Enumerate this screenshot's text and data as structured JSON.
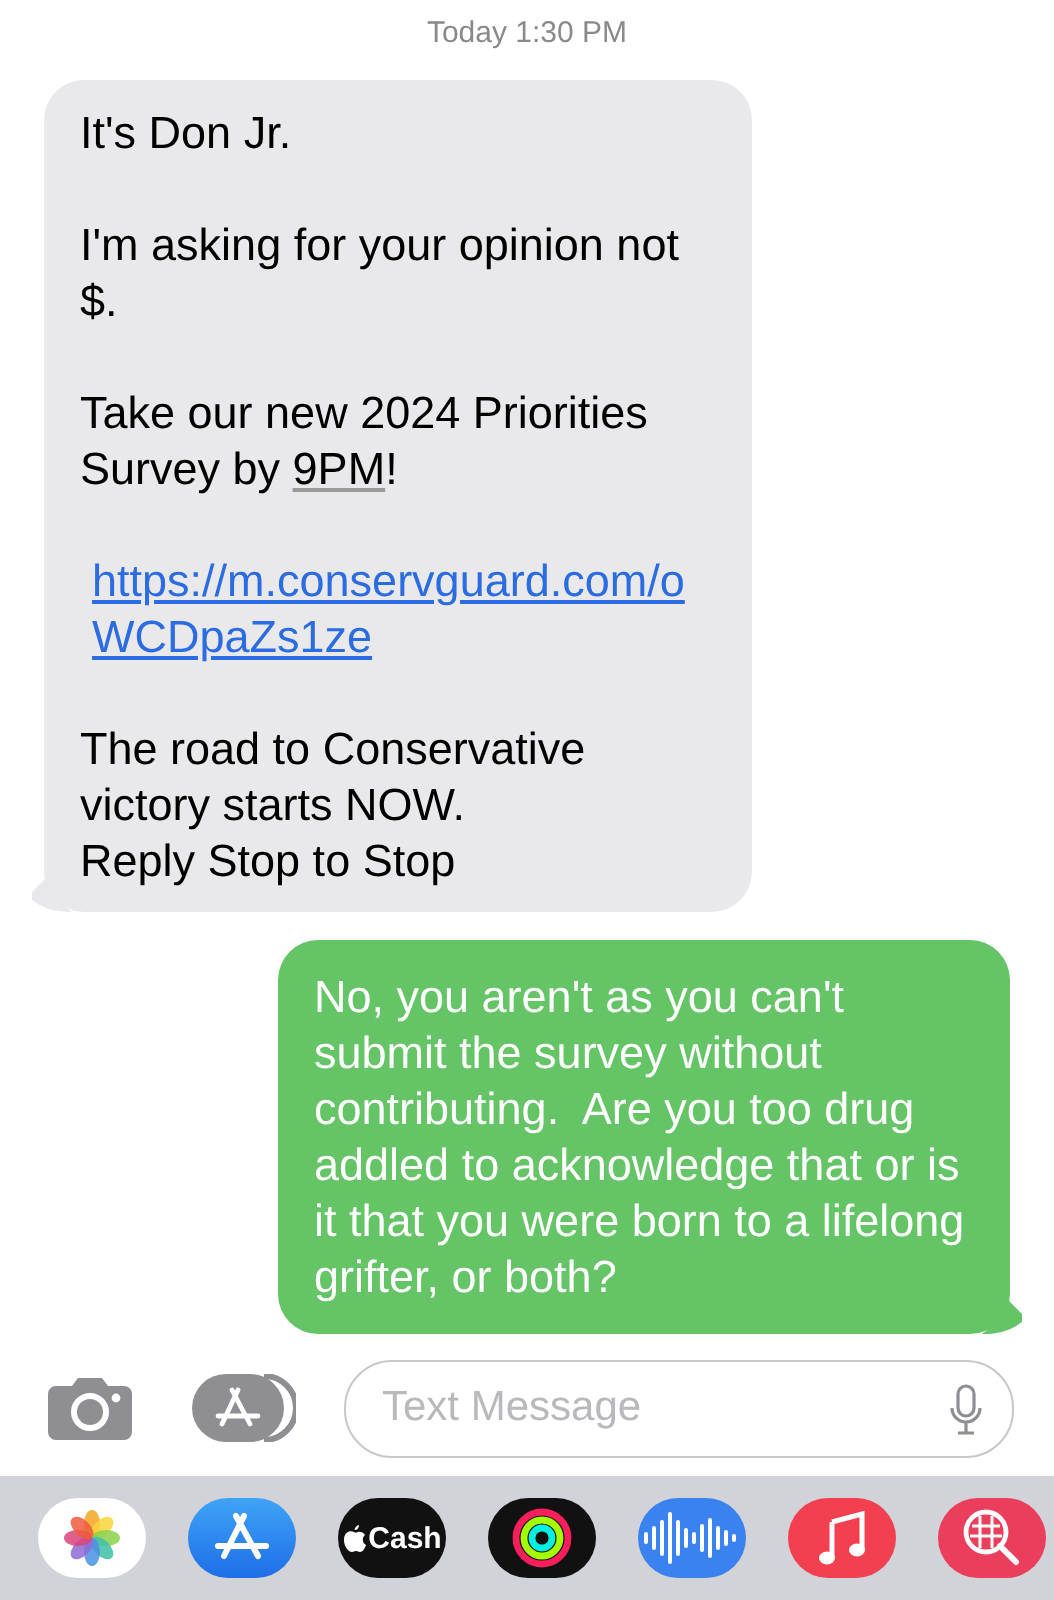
{
  "timestamp": "Today 1:30 PM",
  "messages": [
    {
      "kind": "received",
      "paragraphs": [
        [
          {
            "text": "It's Don Jr."
          }
        ],
        [
          {
            "text": "I'm asking for your opinion not $."
          }
        ],
        [
          {
            "text": "Take our new 2024 Priorities Survey by "
          },
          {
            "text": "9PM",
            "kind": "detected"
          },
          {
            "text": "!"
          }
        ],
        [
          {
            "text": "https://m.conservguard.com/oWCDpaZs1ze",
            "kind": "link"
          }
        ],
        [
          {
            "text": "The road to Conservative victory starts NOW."
          },
          {
            "text": "Reply Stop to Stop",
            "kind": "line"
          }
        ]
      ]
    },
    {
      "kind": "sent",
      "paragraphs": [
        [
          {
            "text": "No, you aren't as you can't submit the survey without contributing.  Are you too drug addled to acknowledge that or is it that you were born to a lifelong grifter, or both?"
          }
        ]
      ]
    }
  ],
  "compose": {
    "placeholder": "Text Message"
  },
  "app_drawer": [
    {
      "kind": "photos"
    },
    {
      "kind": "appstore"
    },
    {
      "kind": "cash"
    },
    {
      "kind": "activity"
    },
    {
      "kind": "audio"
    },
    {
      "kind": "music"
    },
    {
      "kind": "search"
    }
  ],
  "cash_label": "Cash"
}
